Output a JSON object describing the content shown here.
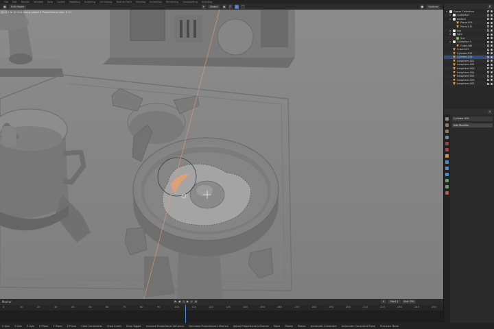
{
  "app": {
    "top_menu": [
      "File",
      "Edit",
      "Render",
      "Window",
      "Help",
      "Layout",
      "Modeling",
      "Sculpting",
      "UV Editing",
      "Texture Paint",
      "Shading",
      "Animation",
      "Rendering",
      "Compositing",
      "Scripting"
    ]
  },
  "viewport_header": {
    "mode": "Edit Mode",
    "transform_orientation": "Global",
    "proportional_label": "Proportional",
    "options_label": "Options"
  },
  "viewport": {
    "status_text": "D: 0.1 m (0.1m) along global X   Proportional size: 0.11",
    "proportional_size": 0.11
  },
  "timeline": {
    "menus": [
      "Marker"
    ],
    "current_frame": "4",
    "start_label": "Start",
    "start_value": "1",
    "end_label": "End",
    "end_value": "250",
    "ruler_ticks": [
      "0",
      "10",
      "20",
      "30",
      "40",
      "50",
      "60",
      "70",
      "80",
      "90",
      "100",
      "110",
      "120",
      "130",
      "140",
      "150",
      "160",
      "170",
      "180",
      "190",
      "200",
      "210",
      "220",
      "230",
      "240",
      "250"
    ]
  },
  "statusbar": {
    "hints": [
      "X Axis",
      "Y Axis",
      "Z Axis",
      "X Plane",
      "Y Plane",
      "Z Plane",
      "Clear Constraints",
      "Snap Invert",
      "Snap Toggle",
      "Increase Proportional Influence",
      "Decrease Proportional Influence",
      "Adjust Proportional Influence",
      "Move",
      "Rotate",
      "Resize",
      "Automatic Constraint",
      "Automatic Constraint Plane",
      "Precision Mode"
    ]
  },
  "outliner": {
    "rows": [
      {
        "label": "Scene Collection",
        "indent": 0,
        "icon": "collection-icon",
        "type": "col",
        "selected": false
      },
      {
        "label": "Collection",
        "indent": 1,
        "icon": "collection-icon",
        "type": "col",
        "selected": false
      },
      {
        "label": "bottom",
        "indent": 1,
        "icon": "collection-icon",
        "type": "col",
        "selected": false
      },
      {
        "label": "Plane.001",
        "indent": 2,
        "icon": "mesh-icon",
        "type": "mesh",
        "selected": false
      },
      {
        "label": "Plane.011",
        "indent": 2,
        "icon": "mesh-icon",
        "type": "mesh",
        "selected": false
      },
      {
        "label": "top",
        "indent": 1,
        "icon": "collection-icon",
        "type": "col",
        "selected": false
      },
      {
        "label": "light",
        "indent": 1,
        "icon": "collection-icon",
        "type": "col",
        "selected": false
      },
      {
        "label": "Sun",
        "indent": 2,
        "icon": "light-icon",
        "type": "light",
        "selected": false
      },
      {
        "label": "Collection 5",
        "indent": 1,
        "icon": "collection-icon",
        "type": "col",
        "selected": false
      },
      {
        "label": "Cube.085",
        "indent": 2,
        "icon": "mesh-icon",
        "type": "mesh",
        "selected": false
      },
      {
        "label": "Cube.047",
        "indent": 1,
        "icon": "mesh-icon",
        "type": "mesh",
        "selected": false
      },
      {
        "label": "Cylinder.012",
        "indent": 1,
        "icon": "mesh-icon",
        "type": "mesh",
        "selected": false
      },
      {
        "label": "Cylinder.016",
        "indent": 1,
        "icon": "mesh-icon",
        "type": "mesh",
        "selected": true
      },
      {
        "label": "Icosphere.001",
        "indent": 1,
        "icon": "mesh-icon",
        "type": "mesh",
        "selected": false
      },
      {
        "label": "Icosphere.002",
        "indent": 1,
        "icon": "mesh-icon",
        "type": "mesh",
        "selected": false
      },
      {
        "label": "Icosphere.003",
        "indent": 1,
        "icon": "mesh-icon",
        "type": "mesh",
        "selected": false
      },
      {
        "label": "Icosphere.004",
        "indent": 1,
        "icon": "mesh-icon",
        "type": "mesh",
        "selected": false
      },
      {
        "label": "Icosphere.005",
        "indent": 1,
        "icon": "mesh-icon",
        "type": "mesh",
        "selected": false
      },
      {
        "label": "Icosphere.006",
        "indent": 1,
        "icon": "mesh-icon",
        "type": "mesh",
        "selected": false
      },
      {
        "label": "Icosphere.007",
        "indent": 1,
        "icon": "mesh-icon",
        "type": "mesh",
        "selected": false
      }
    ]
  },
  "properties": {
    "object_name": "Cylinder.059",
    "add_modifier_label": "Add Modifier"
  },
  "colors": {
    "viewport_bg": "#8a8a8a",
    "panel_bg": "#282828",
    "selection": "#334d80",
    "accent_blue": "#4772b3",
    "mesh_orange": "#f0a040"
  }
}
